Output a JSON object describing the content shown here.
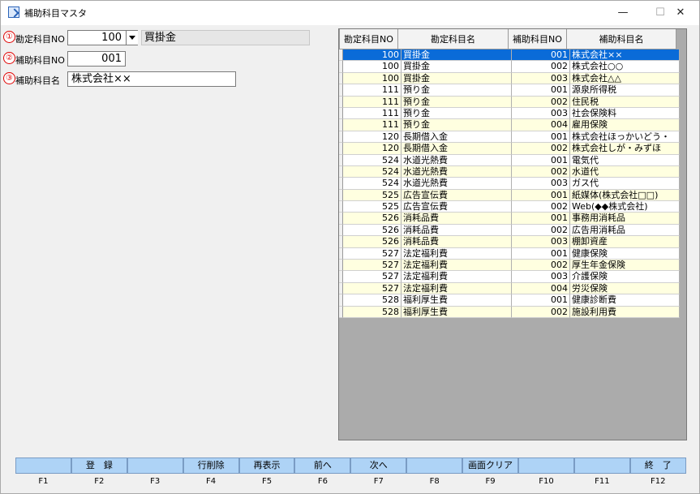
{
  "window": {
    "title": "補助科目マスタ",
    "min_glyph": "—",
    "max_glyph": "☐",
    "close_glyph": "✕"
  },
  "form": {
    "field1": {
      "num": "①",
      "label": "勘定科目NO",
      "value": "100",
      "name": "買掛金"
    },
    "field2": {
      "num": "②",
      "label": "補助科目NO",
      "value": "001"
    },
    "field3": {
      "num": "③",
      "label": "補助科目名",
      "value": "株式会社××"
    }
  },
  "grid": {
    "headers": [
      "勘定科目NO",
      "勘定科目名",
      "補助科目NO",
      "補助科目名"
    ],
    "rows": [
      [
        "100",
        "買掛金",
        "001",
        "株式会社××"
      ],
      [
        "100",
        "買掛金",
        "002",
        "株式会社○○"
      ],
      [
        "100",
        "買掛金",
        "003",
        "株式会社△△"
      ],
      [
        "111",
        "預り金",
        "001",
        "源泉所得税"
      ],
      [
        "111",
        "預り金",
        "002",
        "住民税"
      ],
      [
        "111",
        "預り金",
        "003",
        "社会保険料"
      ],
      [
        "111",
        "預り金",
        "004",
        "雇用保険"
      ],
      [
        "120",
        "長期借入金",
        "001",
        "株式会社ほっかいどう・"
      ],
      [
        "120",
        "長期借入金",
        "002",
        "株式会社しが・みずほ"
      ],
      [
        "524",
        "水道光熱費",
        "001",
        "電気代"
      ],
      [
        "524",
        "水道光熱費",
        "002",
        "水道代"
      ],
      [
        "524",
        "水道光熱費",
        "003",
        "ガス代"
      ],
      [
        "525",
        "広告宣伝費",
        "001",
        "紙媒体(株式会社□□)"
      ],
      [
        "525",
        "広告宣伝費",
        "002",
        "Web(◆◆株式会社)"
      ],
      [
        "526",
        "消耗品費",
        "001",
        "事務用消耗品"
      ],
      [
        "526",
        "消耗品費",
        "002",
        "広告用消耗品"
      ],
      [
        "526",
        "消耗品費",
        "003",
        "棚卸資産"
      ],
      [
        "527",
        "法定福利費",
        "001",
        "健康保険"
      ],
      [
        "527",
        "法定福利費",
        "002",
        "厚生年金保険"
      ],
      [
        "527",
        "法定福利費",
        "003",
        "介護保険"
      ],
      [
        "527",
        "法定福利費",
        "004",
        "労災保険"
      ],
      [
        "528",
        "福利厚生費",
        "001",
        "健康診断費"
      ],
      [
        "528",
        "福利厚生費",
        "002",
        "施設利用費"
      ]
    ],
    "selected_index": 0
  },
  "fkeys": {
    "buttons": [
      "",
      "登　録",
      "",
      "行削除",
      "再表示",
      "前へ",
      "次へ",
      "",
      "画面クリア",
      "",
      "",
      "終　了"
    ],
    "labels": [
      "F1",
      "F2",
      "F3",
      "F4",
      "F5",
      "F6",
      "F7",
      "F8",
      "F9",
      "F10",
      "F11",
      "F12"
    ]
  },
  "colors": {
    "selected_row": "#0a6bd8",
    "alt_row": "#ffffe0",
    "fkey_button": "#aed3f6",
    "field_marker": "#e00000"
  }
}
